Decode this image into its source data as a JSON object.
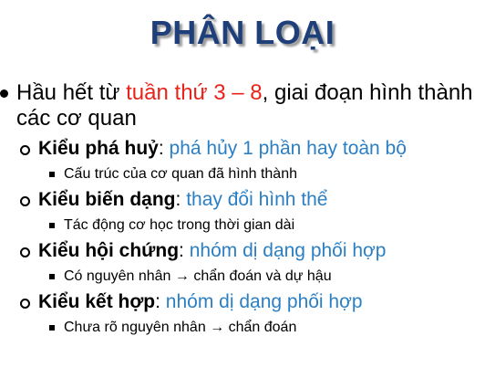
{
  "title": "PHÂN LOẠI",
  "main_point": {
    "prefix": "Hầu hết từ ",
    "highlight": "tuần thứ 3 – 8",
    "suffix": ", giai đoạn hình thành các cơ quan"
  },
  "types": [
    {
      "label": "Kiểu phá huỷ",
      "separator": ": ",
      "description": "phá hủy 1 phần hay toàn bộ",
      "detail": "Cấu trúc của cơ quan đã hình thành"
    },
    {
      "label": "Kiểu biến dạng",
      "separator": ": ",
      "description": "thay đổi hình thể",
      "detail": "Tác động cơ học trong thời gian dài"
    },
    {
      "label": "Kiểu hội chứng",
      "separator": ": ",
      "description": "nhóm dị dạng phối hợp",
      "detail": "Có nguyên nhân → chẩn đoán và dự hậu"
    },
    {
      "label": "Kiểu kết hợp",
      "separator": ": ",
      "description": "nhóm dị dạng phối hợp",
      "detail": "Chưa rõ nguyên nhân → chẩn đoán"
    }
  ],
  "colors": {
    "title": "#1f3f7a",
    "highlight_red": "#e8231b",
    "description_blue": "#2b7fc4"
  }
}
